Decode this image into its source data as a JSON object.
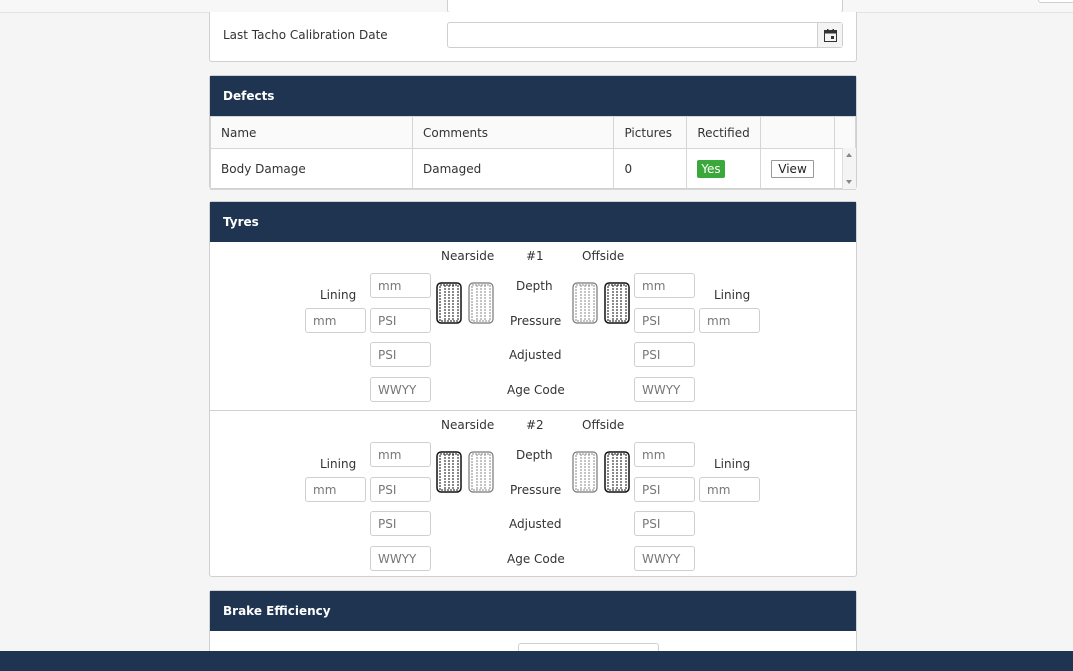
{
  "calibration": {
    "label": "Last Tacho Calibration Date",
    "value": ""
  },
  "defects": {
    "title": "Defects",
    "columns": [
      "Name",
      "Comments",
      "Pictures",
      "Rectified",
      ""
    ],
    "rows": [
      {
        "name": "Body Damage",
        "comments": "Damaged",
        "pictures": "0",
        "rectified": "Yes",
        "action": "View"
      }
    ],
    "colors": {
      "rectified_yes": "#3aa83a"
    }
  },
  "tyres": {
    "title": "Tyres",
    "axles": [
      {
        "number": "#1",
        "nearside": "Nearside",
        "offside": "Offside",
        "lining_left": "Lining",
        "lining_right": "Lining",
        "depth": "Depth",
        "pressure": "Pressure",
        "adjusted": "Adjusted",
        "age_code": "Age Code",
        "placeholders": {
          "mm": "mm",
          "psi": "PSI",
          "wwyy": "WWYY"
        }
      },
      {
        "number": "#2",
        "nearside": "Nearside",
        "offside": "Offside",
        "lining_left": "Lining",
        "lining_right": "Lining",
        "depth": "Depth",
        "pressure": "Pressure",
        "adjusted": "Adjusted",
        "age_code": "Age Code",
        "placeholders": {
          "mm": "mm",
          "psi": "PSI",
          "wwyy": "WWYY"
        }
      }
    ]
  },
  "brake": {
    "title": "Brake Efficiency"
  },
  "theme": {
    "header_bg": "#1f3450",
    "header_text": "#ffffff"
  },
  "icons": {
    "calendar": "calendar-icon",
    "tyre": "tyre-icon"
  }
}
